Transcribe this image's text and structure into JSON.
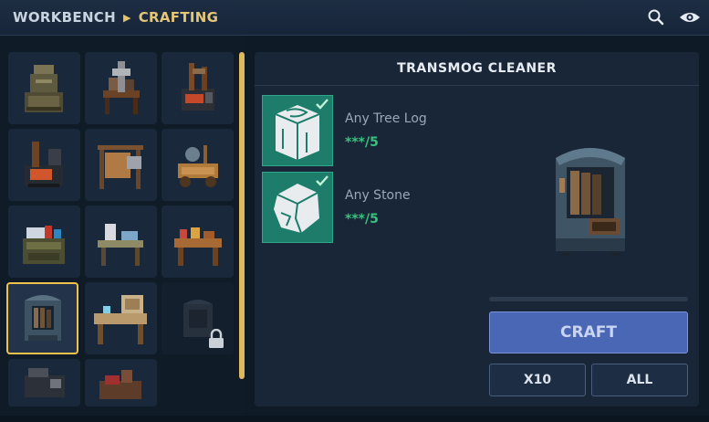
{
  "breadcrumb": {
    "parent": "WORKBENCH",
    "current": "CRAFTING"
  },
  "header_icons": [
    "search-icon",
    "eye-icon"
  ],
  "recipe": {
    "title": "TRANSMOG CLEANER",
    "ingredients": [
      {
        "name": "Any Tree Log",
        "qty": "***/5",
        "icon": "tree-log-icon"
      },
      {
        "name": "Any Stone",
        "qty": "***/5",
        "icon": "stone-icon"
      }
    ]
  },
  "buttons": {
    "craft": "CRAFT",
    "x10": "X10",
    "all": "ALL"
  },
  "grid": {
    "selected_index": 9,
    "locked_index": 11
  },
  "colors": {
    "accent": "#e5c677",
    "ok": "#38c27e",
    "craft": "#4a67b6"
  }
}
